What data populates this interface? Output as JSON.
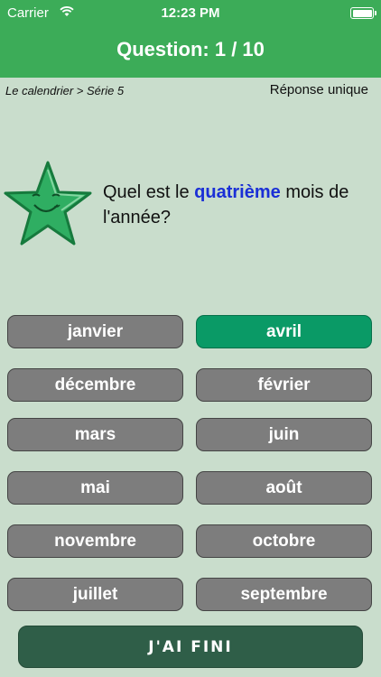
{
  "status_bar": {
    "carrier": "Carrier",
    "time": "12:23 PM"
  },
  "header": {
    "title": "Question: 1 / 10"
  },
  "breadcrumb": "Le calendrier > Série 5",
  "mode": "Réponse unique",
  "question": {
    "before": "Quel est le ",
    "keyword": "quatrième",
    "after": " mois de l'année?"
  },
  "answers": [
    {
      "label": "janvier",
      "selected": false
    },
    {
      "label": "avril",
      "selected": true
    },
    {
      "label": "décembre",
      "selected": false
    },
    {
      "label": "février",
      "selected": false
    },
    {
      "label": "mars",
      "selected": false
    },
    {
      "label": "juin",
      "selected": false
    },
    {
      "label": "mai",
      "selected": false
    },
    {
      "label": "août",
      "selected": false
    },
    {
      "label": "novembre",
      "selected": false
    },
    {
      "label": "octobre",
      "selected": false
    },
    {
      "label": "juillet",
      "selected": false
    },
    {
      "label": "septembre",
      "selected": false
    }
  ],
  "finish_button": "J'AI FINI",
  "colors": {
    "header": "#3cac58",
    "background": "#c9ddcc",
    "button": "#7d7d7d",
    "selected": "#0a9a66",
    "keyword": "#1a2fd6",
    "finish": "#2f5e48"
  }
}
